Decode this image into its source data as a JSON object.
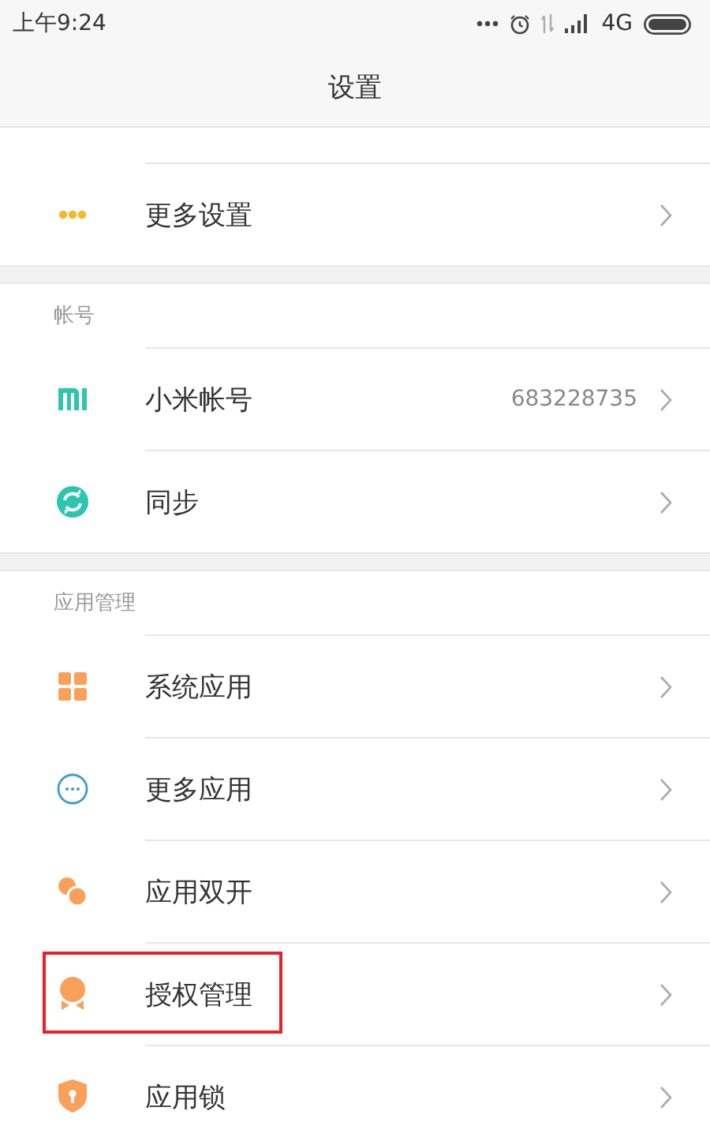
{
  "status_bar": {
    "time": "上午9:24",
    "network": "4G"
  },
  "header": {
    "title": "设置"
  },
  "sections": [
    {
      "items": [
        {
          "kind": "dots",
          "label": "更多设置",
          "highlighted": false
        }
      ]
    },
    {
      "title": "帐号",
      "items": [
        {
          "kind": "mi",
          "label": "小米帐号",
          "value": "683228735",
          "highlighted": false
        },
        {
          "kind": "sync",
          "label": "同步",
          "highlighted": false
        }
      ]
    },
    {
      "title": "应用管理",
      "items": [
        {
          "kind": "grid",
          "label": "系统应用",
          "highlighted": false
        },
        {
          "kind": "more",
          "label": "更多应用",
          "highlighted": false
        },
        {
          "kind": "dual",
          "label": "应用双开",
          "highlighted": false
        },
        {
          "kind": "badge",
          "label": "授权管理",
          "highlighted": true
        },
        {
          "kind": "lock",
          "label": "应用锁",
          "highlighted": false
        }
      ]
    }
  ]
}
